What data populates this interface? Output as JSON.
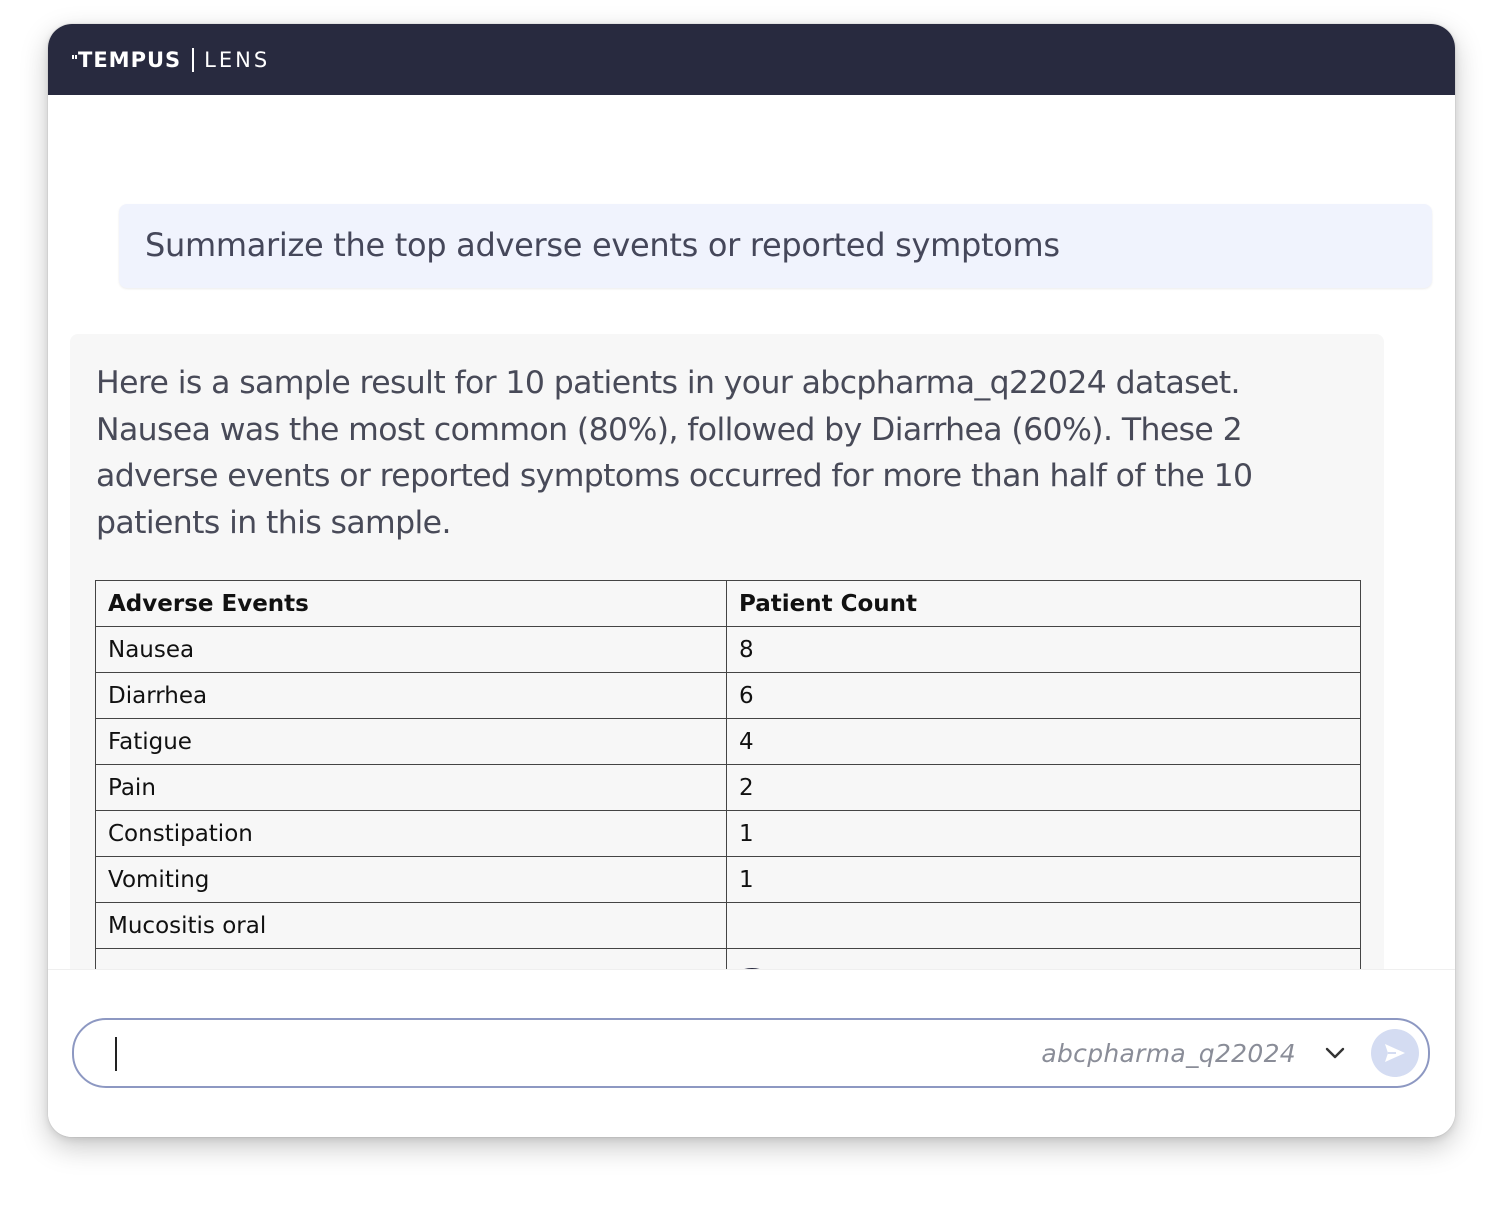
{
  "header": {
    "brand": "TEMPUS",
    "product": "LENS"
  },
  "conversation": {
    "user_message": "Summarize the top adverse events or reported symptoms",
    "assistant_message": "Here is a sample result for 10 patients in your abcpharma_q22024 dataset. Nausea was the most common (80%), followed by Diarrhea (60%). These 2 adverse events or reported symptoms occurred for more than half of the 10 patients in this sample.",
    "table": {
      "columns": [
        "Adverse Events",
        "Patient Count"
      ],
      "rows": [
        [
          "Nausea",
          "8"
        ],
        [
          "Diarrhea",
          "6"
        ],
        [
          "Fatigue",
          "4"
        ],
        [
          "Pain",
          "2"
        ],
        [
          "Constipation",
          "1"
        ],
        [
          "Vomiting",
          "1"
        ],
        [
          "Mucositis oral",
          ""
        ]
      ]
    }
  },
  "composer": {
    "input_value": "",
    "dataset_selected": "abcpharma_q22024"
  },
  "icons": {
    "scroll_down": "arrow-down-icon",
    "dataset_dropdown": "chevron-down-icon",
    "send": "send-icon"
  },
  "colors": {
    "header_bg": "#282a3f",
    "user_bubble_bg": "#f0f3fd",
    "assistant_bubble_bg": "#f7f7f7",
    "composer_border": "#8d98c2",
    "send_button_bg": "#d4dcf2"
  }
}
